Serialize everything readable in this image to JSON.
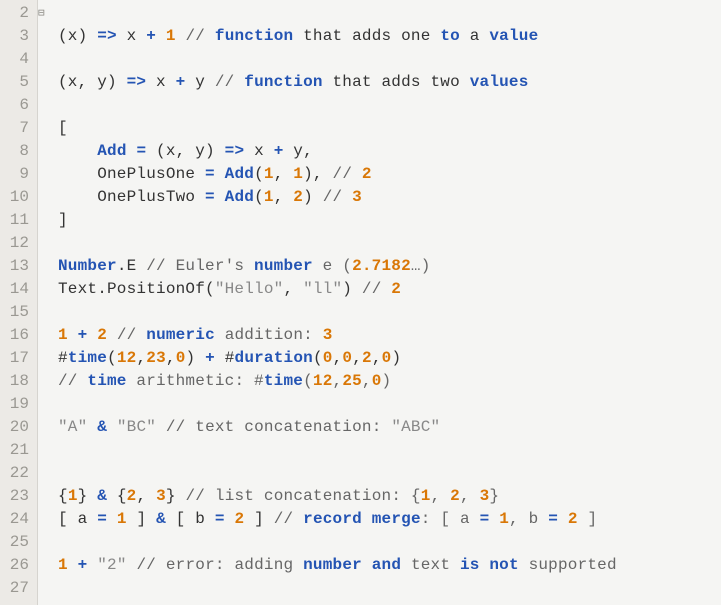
{
  "editor": {
    "lineNumbers": [
      "2",
      "3",
      "4",
      "5",
      "6",
      "7",
      "8",
      "9",
      "10",
      "11",
      "12",
      "13",
      "14",
      "15",
      "16",
      "17",
      "18",
      "19",
      "20",
      "21",
      "22",
      "23",
      "24",
      "25",
      "26",
      "27"
    ],
    "foldMarkLine": 24,
    "lines": {
      "l2": [],
      "l3": [
        {
          "t": "(x) ",
          "c": "plain"
        },
        {
          "t": "=>",
          "c": "kw-blue"
        },
        {
          "t": " x ",
          "c": "plain"
        },
        {
          "t": "+",
          "c": "op"
        },
        {
          "t": " ",
          "c": "plain"
        },
        {
          "t": "1",
          "c": "num"
        },
        {
          "t": " // ",
          "c": "cm-grey"
        },
        {
          "t": "function",
          "c": "cm-kw"
        },
        {
          "t": " that adds one ",
          "c": "cm"
        },
        {
          "t": "to",
          "c": "cm-kw"
        },
        {
          "t": " a ",
          "c": "cm"
        },
        {
          "t": "value",
          "c": "cm-kw"
        }
      ],
      "l4": [],
      "l5": [
        {
          "t": "(x, y) ",
          "c": "plain"
        },
        {
          "t": "=>",
          "c": "kw-blue"
        },
        {
          "t": " x ",
          "c": "plain"
        },
        {
          "t": "+",
          "c": "op"
        },
        {
          "t": " y ",
          "c": "plain"
        },
        {
          "t": "// ",
          "c": "cm-grey"
        },
        {
          "t": "function",
          "c": "cm-kw"
        },
        {
          "t": " that adds two ",
          "c": "cm"
        },
        {
          "t": "values",
          "c": "cm-kw"
        }
      ],
      "l6": [],
      "l7": [
        {
          "t": "[",
          "c": "plain"
        }
      ],
      "l8": [
        {
          "t": "    ",
          "c": "plain"
        },
        {
          "t": "Add",
          "c": "kw-blue"
        },
        {
          "t": " ",
          "c": "plain"
        },
        {
          "t": "=",
          "c": "op"
        },
        {
          "t": " (x, y) ",
          "c": "plain"
        },
        {
          "t": "=>",
          "c": "kw-blue"
        },
        {
          "t": " x ",
          "c": "plain"
        },
        {
          "t": "+",
          "c": "op"
        },
        {
          "t": " y,",
          "c": "plain"
        }
      ],
      "l9": [
        {
          "t": "    OnePlusOne ",
          "c": "plain"
        },
        {
          "t": "=",
          "c": "op"
        },
        {
          "t": " ",
          "c": "plain"
        },
        {
          "t": "Add",
          "c": "kw-blue"
        },
        {
          "t": "(",
          "c": "plain"
        },
        {
          "t": "1",
          "c": "num"
        },
        {
          "t": ", ",
          "c": "plain"
        },
        {
          "t": "1",
          "c": "num"
        },
        {
          "t": "), ",
          "c": "plain"
        },
        {
          "t": "// ",
          "c": "cm-grey"
        },
        {
          "t": "2",
          "c": "num"
        }
      ],
      "l10": [
        {
          "t": "    OnePlusTwo ",
          "c": "plain"
        },
        {
          "t": "=",
          "c": "op"
        },
        {
          "t": " ",
          "c": "plain"
        },
        {
          "t": "Add",
          "c": "kw-blue"
        },
        {
          "t": "(",
          "c": "plain"
        },
        {
          "t": "1",
          "c": "num"
        },
        {
          "t": ", ",
          "c": "plain"
        },
        {
          "t": "2",
          "c": "num"
        },
        {
          "t": ") ",
          "c": "plain"
        },
        {
          "t": "// ",
          "c": "cm-grey"
        },
        {
          "t": "3",
          "c": "num"
        }
      ],
      "l11": [
        {
          "t": "]",
          "c": "plain"
        }
      ],
      "l12": [],
      "l13": [
        {
          "t": "Number",
          "c": "kw-blue"
        },
        {
          "t": ".E ",
          "c": "plain"
        },
        {
          "t": "// Euler's ",
          "c": "cm-grey"
        },
        {
          "t": "number",
          "c": "cm-kw"
        },
        {
          "t": " e (",
          "c": "cm-grey"
        },
        {
          "t": "2.7182",
          "c": "num"
        },
        {
          "t": "…)",
          "c": "cm-grey"
        }
      ],
      "l14": [
        {
          "t": "Text.PositionOf(",
          "c": "plain"
        },
        {
          "t": "\"Hello\"",
          "c": "str"
        },
        {
          "t": ", ",
          "c": "plain"
        },
        {
          "t": "\"ll\"",
          "c": "str"
        },
        {
          "t": ") ",
          "c": "plain"
        },
        {
          "t": "// ",
          "c": "cm-grey"
        },
        {
          "t": "2",
          "c": "num"
        }
      ],
      "l15": [],
      "l16": [
        {
          "t": "1",
          "c": "num"
        },
        {
          "t": " ",
          "c": "plain"
        },
        {
          "t": "+",
          "c": "op"
        },
        {
          "t": " ",
          "c": "plain"
        },
        {
          "t": "2",
          "c": "num"
        },
        {
          "t": " ",
          "c": "plain"
        },
        {
          "t": "// ",
          "c": "cm-grey"
        },
        {
          "t": "numeric",
          "c": "cm-kw"
        },
        {
          "t": " addition: ",
          "c": "cm-grey"
        },
        {
          "t": "3",
          "c": "num"
        }
      ],
      "l17": [
        {
          "t": "#",
          "c": "plain"
        },
        {
          "t": "time",
          "c": "kw-blue"
        },
        {
          "t": "(",
          "c": "plain"
        },
        {
          "t": "12",
          "c": "num"
        },
        {
          "t": ",",
          "c": "plain"
        },
        {
          "t": "23",
          "c": "num"
        },
        {
          "t": ",",
          "c": "plain"
        },
        {
          "t": "0",
          "c": "num"
        },
        {
          "t": ") ",
          "c": "plain"
        },
        {
          "t": "+",
          "c": "op"
        },
        {
          "t": " #",
          "c": "plain"
        },
        {
          "t": "duration",
          "c": "kw-blue"
        },
        {
          "t": "(",
          "c": "plain"
        },
        {
          "t": "0",
          "c": "num"
        },
        {
          "t": ",",
          "c": "plain"
        },
        {
          "t": "0",
          "c": "num"
        },
        {
          "t": ",",
          "c": "plain"
        },
        {
          "t": "2",
          "c": "num"
        },
        {
          "t": ",",
          "c": "plain"
        },
        {
          "t": "0",
          "c": "num"
        },
        {
          "t": ")",
          "c": "plain"
        }
      ],
      "l18": [
        {
          "t": "// ",
          "c": "cm-grey"
        },
        {
          "t": "time",
          "c": "cm-kw"
        },
        {
          "t": " arithmetic: #",
          "c": "cm-grey"
        },
        {
          "t": "time",
          "c": "cm-kw"
        },
        {
          "t": "(",
          "c": "cm-grey"
        },
        {
          "t": "12",
          "c": "num"
        },
        {
          "t": ",",
          "c": "cm-grey"
        },
        {
          "t": "25",
          "c": "num"
        },
        {
          "t": ",",
          "c": "cm-grey"
        },
        {
          "t": "0",
          "c": "num"
        },
        {
          "t": ")",
          "c": "cm-grey"
        }
      ],
      "l19": [],
      "l20": [
        {
          "t": "\"A\"",
          "c": "str"
        },
        {
          "t": " ",
          "c": "plain"
        },
        {
          "t": "&",
          "c": "op"
        },
        {
          "t": " ",
          "c": "plain"
        },
        {
          "t": "\"BC\"",
          "c": "str"
        },
        {
          "t": " ",
          "c": "plain"
        },
        {
          "t": "// text concatenation: ",
          "c": "cm-grey"
        },
        {
          "t": "\"ABC\"",
          "c": "str"
        }
      ],
      "l21": [],
      "l22": [],
      "l23": [
        {
          "t": "{",
          "c": "plain"
        },
        {
          "t": "1",
          "c": "num"
        },
        {
          "t": "} ",
          "c": "plain"
        },
        {
          "t": "&",
          "c": "op"
        },
        {
          "t": " {",
          "c": "plain"
        },
        {
          "t": "2",
          "c": "num"
        },
        {
          "t": ", ",
          "c": "plain"
        },
        {
          "t": "3",
          "c": "num"
        },
        {
          "t": "} ",
          "c": "plain"
        },
        {
          "t": "// list concatenation: {",
          "c": "cm-grey"
        },
        {
          "t": "1",
          "c": "num"
        },
        {
          "t": ", ",
          "c": "cm-grey"
        },
        {
          "t": "2",
          "c": "num"
        },
        {
          "t": ", ",
          "c": "cm-grey"
        },
        {
          "t": "3",
          "c": "num"
        },
        {
          "t": "}",
          "c": "cm-grey"
        }
      ],
      "l24": [
        {
          "t": "[ a ",
          "c": "plain"
        },
        {
          "t": "=",
          "c": "op"
        },
        {
          "t": " ",
          "c": "plain"
        },
        {
          "t": "1",
          "c": "num"
        },
        {
          "t": " ] ",
          "c": "plain"
        },
        {
          "t": "&",
          "c": "op"
        },
        {
          "t": " [ b ",
          "c": "plain"
        },
        {
          "t": "=",
          "c": "op"
        },
        {
          "t": " ",
          "c": "plain"
        },
        {
          "t": "2",
          "c": "num"
        },
        {
          "t": " ] ",
          "c": "plain"
        },
        {
          "t": "// ",
          "c": "cm-grey"
        },
        {
          "t": "record merge",
          "c": "cm-kw"
        },
        {
          "t": ": [ a ",
          "c": "cm-grey"
        },
        {
          "t": "=",
          "c": "op"
        },
        {
          "t": " ",
          "c": "cm-grey"
        },
        {
          "t": "1",
          "c": "num"
        },
        {
          "t": ", b ",
          "c": "cm-grey"
        },
        {
          "t": "=",
          "c": "op"
        },
        {
          "t": " ",
          "c": "cm-grey"
        },
        {
          "t": "2",
          "c": "num"
        },
        {
          "t": " ]",
          "c": "cm-grey"
        }
      ],
      "l25": [],
      "l26": [
        {
          "t": "1",
          "c": "num"
        },
        {
          "t": " ",
          "c": "plain"
        },
        {
          "t": "+",
          "c": "op"
        },
        {
          "t": " ",
          "c": "plain"
        },
        {
          "t": "\"2\"",
          "c": "str"
        },
        {
          "t": " ",
          "c": "plain"
        },
        {
          "t": "// error: adding ",
          "c": "cm-grey"
        },
        {
          "t": "number",
          "c": "cm-kw"
        },
        {
          "t": " ",
          "c": "cm-grey"
        },
        {
          "t": "and",
          "c": "cm-kw"
        },
        {
          "t": " text ",
          "c": "cm-grey"
        },
        {
          "t": "is not",
          "c": "cm-kw"
        },
        {
          "t": " supported",
          "c": "cm-grey"
        }
      ],
      "l27": []
    }
  }
}
